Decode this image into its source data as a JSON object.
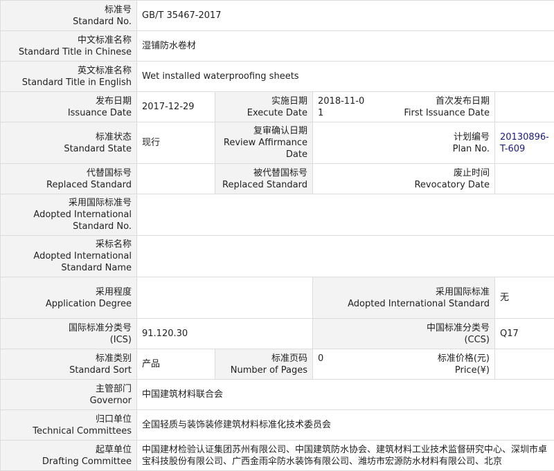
{
  "fields": {
    "standard_no": {
      "label_cn": "标准号",
      "label_en": "Standard No.",
      "value": "GB/T 35467-2017"
    },
    "title_cn": {
      "label_cn": "中文标准名称",
      "label_en": "Standard Title in Chinese",
      "value": "湿铺防水卷材"
    },
    "title_en": {
      "label_cn": "英文标准名称",
      "label_en": "Standard Title in English",
      "value": "Wet installed waterproofing sheets"
    },
    "issuance_date": {
      "label_cn": "发布日期",
      "label_en": "Issuance Date",
      "value": "2017-12-29"
    },
    "execute_date": {
      "label_cn": "实施日期",
      "label_en": "Execute Date",
      "value": "2018-11-01"
    },
    "first_issuance_date": {
      "label_cn": "首次发布日期",
      "label_en": "First Issuance Date",
      "value": ""
    },
    "standard_state": {
      "label_cn": "标准状态",
      "label_en": "Standard State",
      "value": "现行"
    },
    "review_affirmance_date": {
      "label_cn": "复审确认日期",
      "label_en": "Review Affirmance Date",
      "value": ""
    },
    "plan_no": {
      "label_cn": "计划编号",
      "label_en": "Plan No.",
      "value": "20130896-T-609"
    },
    "replaced_standard": {
      "label_cn": "代替国标号",
      "label_en": "Replaced Standard",
      "value": ""
    },
    "replaced_by_standard": {
      "label_cn": "被代替国标号",
      "label_en": "Replaced Standard",
      "value": ""
    },
    "revocatory_date": {
      "label_cn": "废止时间",
      "label_en": "Revocatory Date",
      "value": ""
    },
    "adopted_intl_no": {
      "label_cn": "采用国际标准号",
      "label_en": "Adopted International Standard No.",
      "value": ""
    },
    "adopted_intl_name": {
      "label_cn": "采标名称",
      "label_en": "Adopted International Standard Name",
      "value": ""
    },
    "application_degree": {
      "label_cn": "采用程度",
      "label_en": "Application Degree",
      "value": ""
    },
    "adopted_intl_standard": {
      "label_cn": "采用国际标准",
      "label_en": "Adopted International Standard",
      "value": "无"
    },
    "ics": {
      "label_cn": "国际标准分类号",
      "label_en": "(ICS)",
      "value": "91.120.30"
    },
    "ccs": {
      "label_cn": "中国标准分类号",
      "label_en": "(CCS)",
      "value": "Q17"
    },
    "standard_sort": {
      "label_cn": "标准类别",
      "label_en": "Standard Sort",
      "value": "产品"
    },
    "number_of_pages": {
      "label_cn": "标准页码",
      "label_en": "Number of Pages",
      "value": "0"
    },
    "price": {
      "label_cn": "标准价格(元)",
      "label_en": "Price(¥)",
      "value": ""
    },
    "governor": {
      "label_cn": "主管部门",
      "label_en": "Governor",
      "value": "中国建筑材料联合会"
    },
    "technical_committees": {
      "label_cn": "归口单位",
      "label_en": "Technical Committees",
      "value": "全国轻质与装饰装修建筑材料标准化技术委员会"
    },
    "drafting_committee": {
      "label_cn": "起草单位",
      "label_en": "Drafting Committee",
      "value": "中国建材检验认证集团苏州有限公司、中国建筑防水协会、建筑材料工业技术监督研究中心、深圳市卓宝科技股份有限公司、广西金雨伞防水装饰有限公司、潍坊市宏源防水材料有限公司、北京"
    }
  }
}
